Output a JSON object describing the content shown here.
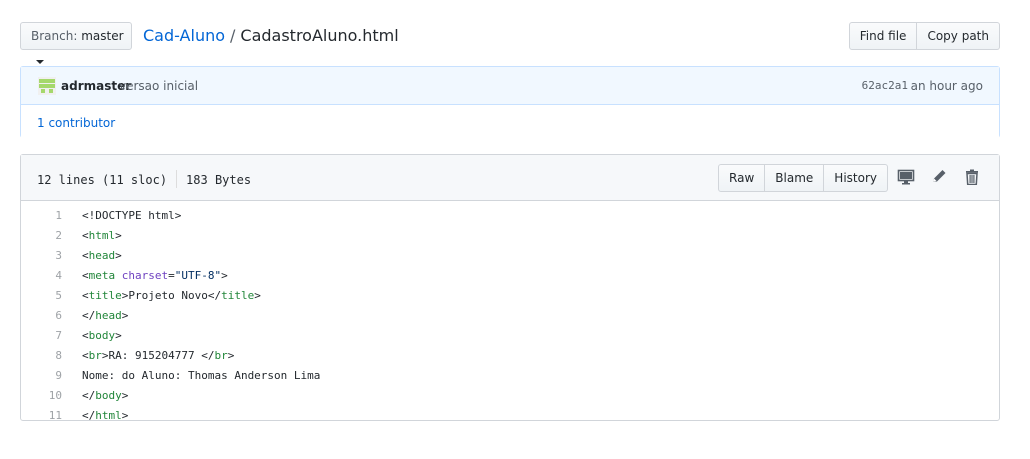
{
  "header": {
    "branch_label": "Branch:",
    "branch_value": "master",
    "repo_name": "Cad-Aluno",
    "separator": "/",
    "file_name": "CadastroAluno.html",
    "find_file_label": "Find file",
    "copy_path_label": "Copy path"
  },
  "commit": {
    "author": "adrmaster",
    "message": "versao inicial",
    "sha": "62ac2a1",
    "time": "an hour ago",
    "contributors": "1 contributor",
    "avatar_icon": "identicon-avatar",
    "avatar_color": "#a5d86c"
  },
  "file": {
    "lines_info": "12 lines (11 sloc)",
    "size_info": "183 Bytes",
    "raw_label": "Raw",
    "blame_label": "Blame",
    "history_label": "History",
    "icons": [
      "desktop-icon",
      "pencil-icon",
      "trash-icon"
    ]
  },
  "code_lines": [
    {
      "num": "1",
      "parts": [
        [
          "t",
          "<!DOCTYPE html>"
        ]
      ]
    },
    {
      "num": "2",
      "parts": [
        [
          "t",
          "<"
        ],
        [
          "g",
          "html"
        ],
        [
          "t",
          ">"
        ]
      ]
    },
    {
      "num": "3",
      "parts": [
        [
          "t",
          "<"
        ],
        [
          "g",
          "head"
        ],
        [
          "t",
          ">"
        ]
      ]
    },
    {
      "num": "4",
      "parts": [
        [
          "t",
          "<"
        ],
        [
          "g",
          "meta"
        ],
        [
          "t",
          " "
        ],
        [
          "a",
          "charset"
        ],
        [
          "t",
          "="
        ],
        [
          "s",
          "\"UTF-8\""
        ],
        [
          "t",
          ">"
        ]
      ]
    },
    {
      "num": "5",
      "parts": [
        [
          "t",
          "<"
        ],
        [
          "g",
          "title"
        ],
        [
          "t",
          ">Projeto Novo</"
        ],
        [
          "g",
          "title"
        ],
        [
          "t",
          ">"
        ]
      ]
    },
    {
      "num": "6",
      "parts": [
        [
          "t",
          "</"
        ],
        [
          "g",
          "head"
        ],
        [
          "t",
          ">"
        ]
      ]
    },
    {
      "num": "7",
      "parts": [
        [
          "t",
          "<"
        ],
        [
          "g",
          "body"
        ],
        [
          "t",
          ">"
        ]
      ]
    },
    {
      "num": "8",
      "parts": [
        [
          "t",
          "<"
        ],
        [
          "g",
          "br"
        ],
        [
          "t",
          ">RA: 915204777 </"
        ],
        [
          "g",
          "br"
        ],
        [
          "t",
          ">"
        ]
      ]
    },
    {
      "num": "9",
      "parts": [
        [
          "t",
          "Nome: do Aluno: Thomas Anderson Lima"
        ]
      ]
    },
    {
      "num": "10",
      "parts": [
        [
          "t",
          "</"
        ],
        [
          "g",
          "body"
        ],
        [
          "t",
          ">"
        ]
      ]
    },
    {
      "num": "11",
      "parts": [
        [
          "t",
          "</"
        ],
        [
          "g",
          "html"
        ],
        [
          "t",
          ">"
        ]
      ]
    }
  ]
}
